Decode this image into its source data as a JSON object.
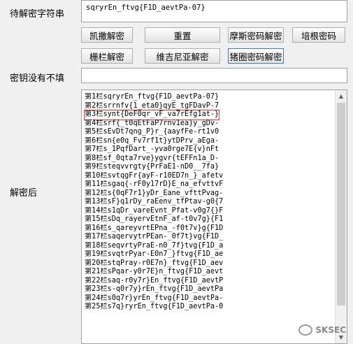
{
  "labels": {
    "ciphertext": "待解密字符串",
    "key": "密钥没有不填",
    "result": "解密后"
  },
  "ciphertext_value": "sqryrEn_ftvg{F1D_aevtPa-07}",
  "key_value": "",
  "buttons": {
    "caesar": "凯撒解密",
    "reset": "重置",
    "morse": "摩斯密码解密",
    "bacon": "培根密码",
    "rail": "栅栏解密",
    "vigenere": "维吉尼亚解密",
    "pigpen": "猪圈密码解密"
  },
  "result_lines": [
    "第1栏sqryrEn_ftvg{F1D_aevtPa-07}",
    "第2栏srrnfv{1_eta0}qyE_tgFDavP-7",
    "第3栏synt{DeF0qr_vF_va7rEfg1at-}",
    "第4栏srf{_t0qEtFaP7rnv1ea}y_gDv-",
    "第5栏sEvDt7qng_P}r_{aayfFe-rt1v0",
    "第6栏sn{e0q_Fv7rf1t}ytDPrv_aEga-",
    "第7栏s_1PqfDart_-yva0rge7E{v}nFt",
    "第8栏sf_0qta7rve}ygvr{tEFFn1a_D-",
    "第9栏steqvvrgty{PrFaE1-nD0__7fa}",
    "第10栏svtqgFr{ayF-r10ED7n_}_afetv",
    "第11栏sgaq{-rF0y17rD}E_na_efvttvF",
    "第12栏s{0qF7r1}yDr_Eane_vfttPvag-",
    "第13栏sF}q1rDy_raEenv_tfPtav-g0{7",
    "第14栏s1qDr_vareEvnt_Pfat-v0g7{}F",
    "第15栏sDq_rayervEtnF_af-t0v7g}{F1",
    "第16栏s_qareyvrtEPna_-f0t7v}g{F1D",
    "第17栏saqervytrPEan-_0f7t}vg{F1D_",
    "第18栏seqvrtyPraE-n0_7f}tvg{F1D_a",
    "第19栏svqtrPyar-E0n7_}ftvg{F1D_ae",
    "第20栏stqPray-r0E7n}_ftvg{F1D_aev",
    "第21栏sPqar-y0r7E}n_ftvg{F1D_aevt",
    "第22栏saq-r0y7r}En_ftvg{F1D_aevtP",
    "第23栏s-q0r7y}rEn_ftvg{F1D_aevtPa",
    "第24栏s0q7r}yrEn_ftvg{F1D_aevtPa-",
    "第25栏s7q}ryrEn_ftvg{F1D_aevtPa-0"
  ],
  "highlight_index": 2,
  "watermark": "SKSEC"
}
